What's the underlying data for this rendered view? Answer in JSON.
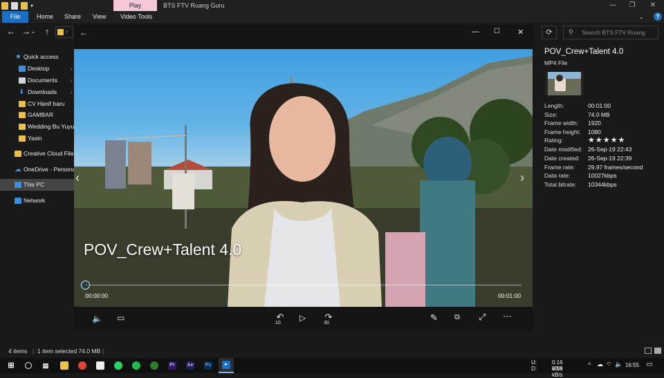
{
  "explorer": {
    "title": "BTS FTV Ruang Guru",
    "contextual_tab": "Play",
    "ribbon_tabs": [
      "File",
      "Home",
      "Share",
      "View",
      "Video Tools"
    ],
    "help": "?",
    "search_placeholder": "Search BTS FTV Ruang Guru"
  },
  "sidebar": {
    "items": [
      {
        "label": "Quick access",
        "icon": "star-icon"
      },
      {
        "label": "Desktop",
        "icon": "desktop-icon"
      },
      {
        "label": "Documents",
        "icon": "document-icon"
      },
      {
        "label": "Downloads",
        "icon": "download-icon"
      },
      {
        "label": "CV Hanif baru",
        "icon": "folder-icon"
      },
      {
        "label": "GAMBAR",
        "icon": "folder-icon"
      },
      {
        "label": "Wedding Bu Yuyu",
        "icon": "folder-icon"
      },
      {
        "label": "Yasin",
        "icon": "folder-icon"
      },
      {
        "label": "Creative Cloud Files",
        "icon": "creative-cloud-icon"
      },
      {
        "label": "OneDrive - Personal",
        "icon": "cloud-icon"
      },
      {
        "label": "This PC",
        "icon": "pc-icon"
      },
      {
        "label": "Network",
        "icon": "network-icon"
      }
    ]
  },
  "details": {
    "name": "POV_Crew+Talent 4.0",
    "type": "MP4 File",
    "rating_stars": 5,
    "properties": [
      {
        "key": "Length:",
        "value": "00:01:00"
      },
      {
        "key": "Size:",
        "value": "74.0 MB"
      },
      {
        "key": "Frame width:",
        "value": "1920"
      },
      {
        "key": "Frame height:",
        "value": "1080"
      },
      {
        "key": "Rating:",
        "value": "★★★★★"
      },
      {
        "key": "Date modified:",
        "value": "26-Sep-19 22:43"
      },
      {
        "key": "Date created:",
        "value": "26-Sep-19 22:39"
      },
      {
        "key": "Frame rate:",
        "value": "29.97 frames/second"
      },
      {
        "key": "Data rate:",
        "value": "10027kbps"
      },
      {
        "key": "Total bitrate:",
        "value": "10344kbps"
      }
    ]
  },
  "status": {
    "items_count": "4 items",
    "selection": "1 item selected  74.0 MB"
  },
  "player": {
    "video_title": "POV_Crew+Talent 4.0",
    "time_current": "00:00:00",
    "time_total": "00:01:00",
    "progress": 0,
    "skip_back_seconds": "10",
    "skip_forward_seconds": "30"
  },
  "tray": {
    "upload_label": "U:",
    "download_label": "D:",
    "upload_speed": "0.16 kB/s",
    "download_speed": "0.18 kB/s",
    "time": "16:55"
  },
  "colors": {
    "accent": "#1a6fc4",
    "play_tab": "#f7c8d9"
  }
}
